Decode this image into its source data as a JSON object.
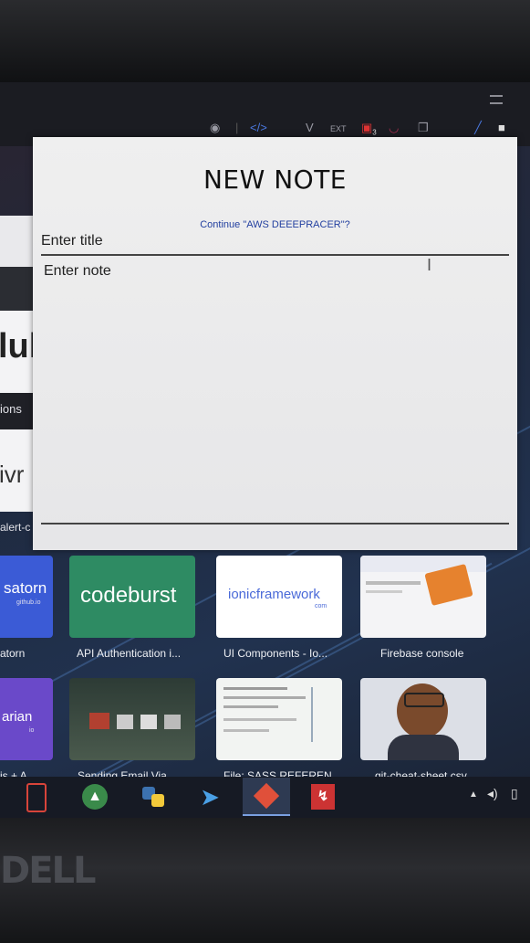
{
  "brand": "DELL",
  "toolbar": {
    "icons": [
      "camera-icon",
      "code-icon",
      "v-icon",
      "ext-icon",
      "badge-icon",
      "pocket-icon",
      "copy-icon",
      "pen-icon",
      "square-icon"
    ],
    "badge_count": "3"
  },
  "left_cards": {
    "logo_fragment": "lul",
    "item1": "ions",
    "item2": "ivr",
    "item3": "alert-c"
  },
  "modal": {
    "title": "NEW NOTE",
    "suggestion": "Continue \"AWS DEEEPRACER\"?",
    "title_placeholder": "Enter title",
    "note_placeholder": "Enter note"
  },
  "tiles_row1": [
    {
      "thumb": "satorn",
      "thumb_sub": "github.io",
      "caption": "atorn"
    },
    {
      "thumb": "codeburst",
      "caption": "API Authentication i..."
    },
    {
      "thumb": "ionicframework",
      "thumb_sub": "com",
      "caption": "UI Components - Io..."
    },
    {
      "thumb": "",
      "caption": "Firebase console"
    }
  ],
  "tiles_row2": [
    {
      "thumb": "arian",
      "thumb_sub": "io",
      "caption": "is + A"
    },
    {
      "thumb": "",
      "caption": "Sending Email Via"
    },
    {
      "thumb": "",
      "caption": "File: SASS REFEREN"
    },
    {
      "thumb": "",
      "caption": "git-cheat-sheet.csv"
    }
  ],
  "taskbar_apps": [
    "phone-app-icon",
    "android-studio-icon",
    "python-icon",
    "dolphin-icon",
    "git-app-icon",
    "pdf-app-icon"
  ],
  "colors": {
    "codeburst_bg": "#2e8b63",
    "ionic_bg": "#ffffff",
    "satorn_bg": "#3b5bd6",
    "arian_bg": "#6a49c9",
    "suggestion": "#2340a0"
  }
}
